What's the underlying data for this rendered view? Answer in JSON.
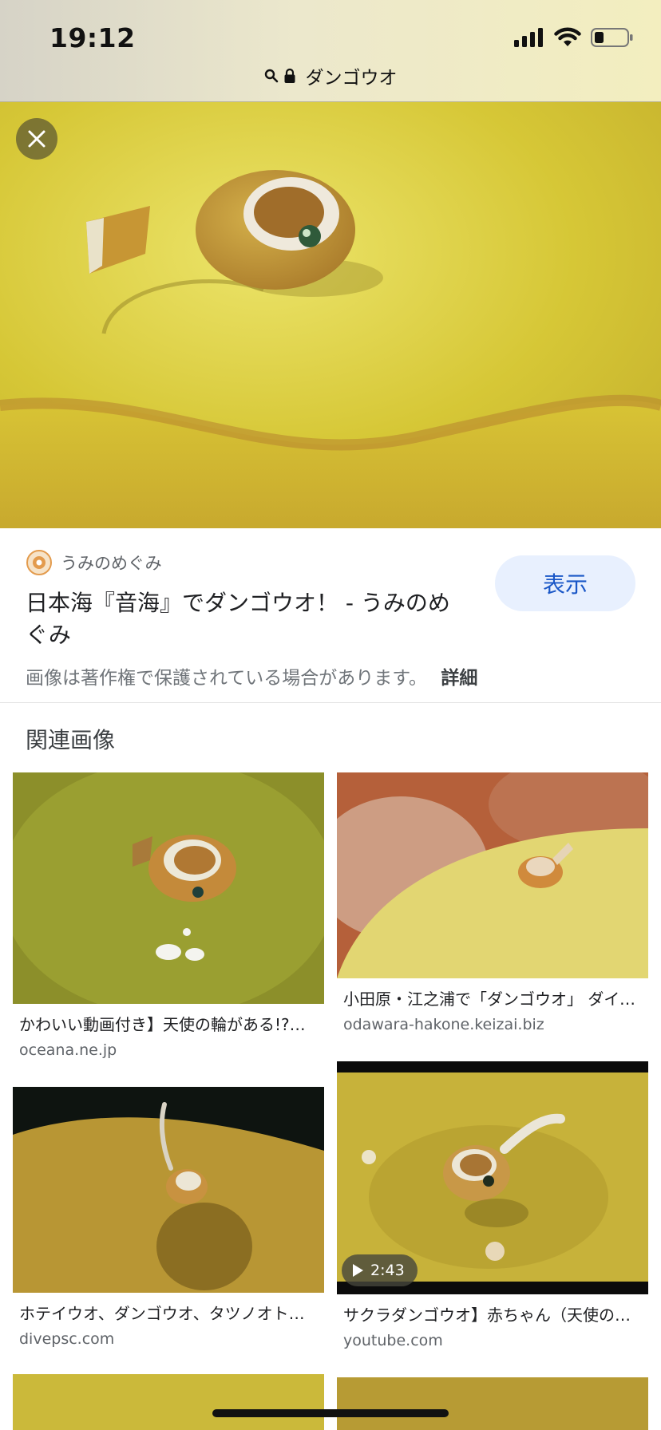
{
  "status_bar": {
    "time": "19:12"
  },
  "url_bar": {
    "query": "ダンゴウオ"
  },
  "source": {
    "site_name": "うみのめぐみ",
    "title": "日本海『音海』でダンゴウオ！ - うみのめぐみ",
    "view_button": "表示",
    "copyright_notice": "画像は著作権で保護されている場合があります。",
    "details_link": "詳細"
  },
  "related": {
    "heading": "関連画像",
    "items": [
      {
        "caption": "かわいい動画付き】天使の輪がある!?ダンゴウオ",
        "domain": "oceana.ne.jp"
      },
      {
        "caption": "小田原・江之浦で「ダンゴウオ」 ダイバーに人気",
        "domain": "odawara-hakone.keizai.biz"
      },
      {
        "caption": "ホテイウオ、ダンゴウオ、タツノオトシゴ",
        "domain": "divepsc.com"
      },
      {
        "caption": "サクラダンゴウオ】赤ちゃん（天使の輪）",
        "domain": "youtube.com",
        "duration": "2:43"
      }
    ]
  },
  "colors": {
    "accent": "#1a57c7",
    "button_bg": "#e8f0fe"
  }
}
